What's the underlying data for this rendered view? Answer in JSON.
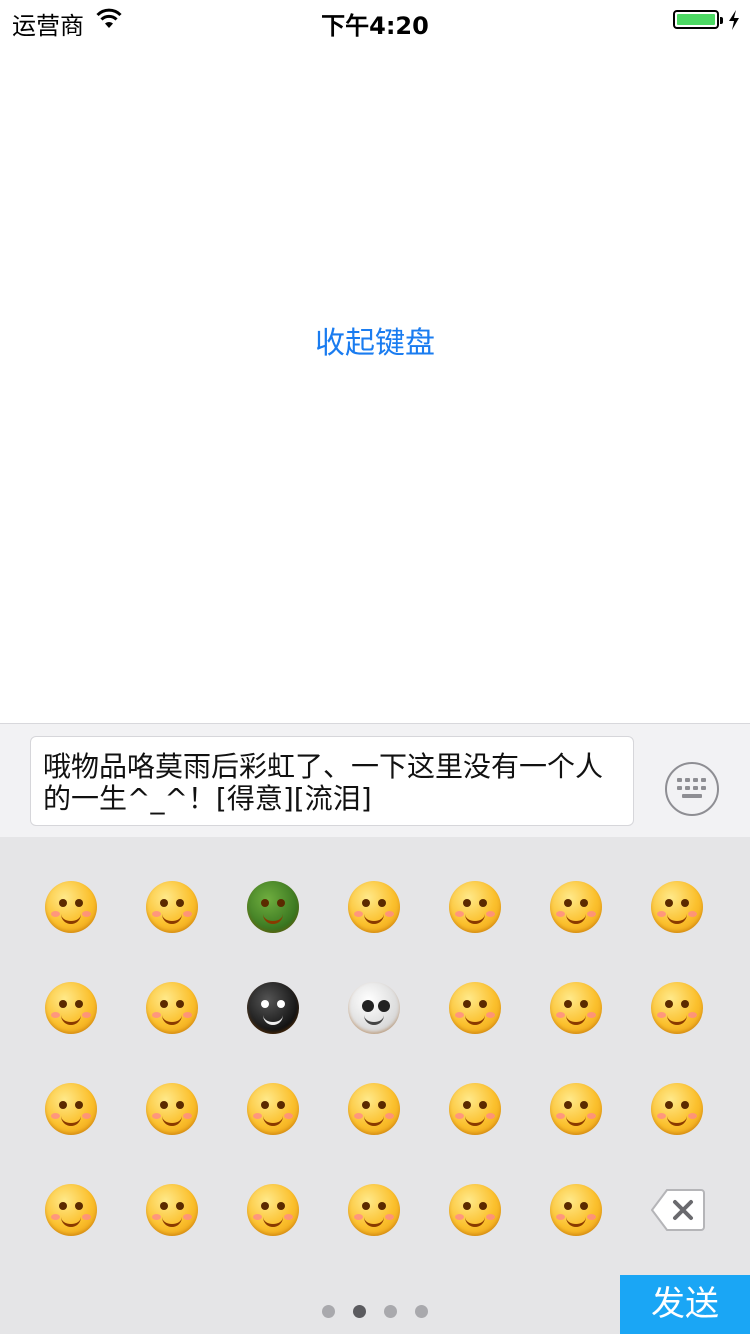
{
  "status_bar": {
    "carrier": "运营商",
    "time": "下午4:20",
    "battery_level": 1.0
  },
  "main": {
    "collapse_keyboard_label": "收起键盘"
  },
  "input": {
    "text": "哦物品咯莫雨后彩虹了、一下这里没有一个人的一生^_^！[得意][流泪]"
  },
  "emoji_panel": {
    "emojis": [
      "smirk-sweat-emoji",
      "grin-emoji",
      "turtle-emoji",
      "headband-frown-emoji",
      "drool-emoji",
      "question-dizzy-emoji",
      "shush-emoji",
      "dizzy-eyes-emoji",
      "squint-laugh-emoji",
      "black-bomb-emoji",
      "skull-emoji",
      "hammer-head-emoji",
      "thinking-emoji",
      "sweat-bored-emoji",
      "pout-blush-emoji",
      "hug-emoji",
      "scared-sweat-emoji",
      "teeth-grin-emoji",
      "wink-left-emoji",
      "wink-right-emoji",
      "pick-nose-emoji",
      "hands-on-hips-emoji",
      "sick-hug-emoji",
      "sad-frown-emoji",
      "evil-grin-emoji",
      "kiss-emoji",
      "faint-purple-emoji"
    ],
    "page_count": 4,
    "active_page": 2,
    "send_label": "发送"
  },
  "colors": {
    "accent": "#1a7cf0",
    "send_bg": "#1aa6f5",
    "panel_bg": "#e5e5e7",
    "battery": "#4cd964"
  }
}
